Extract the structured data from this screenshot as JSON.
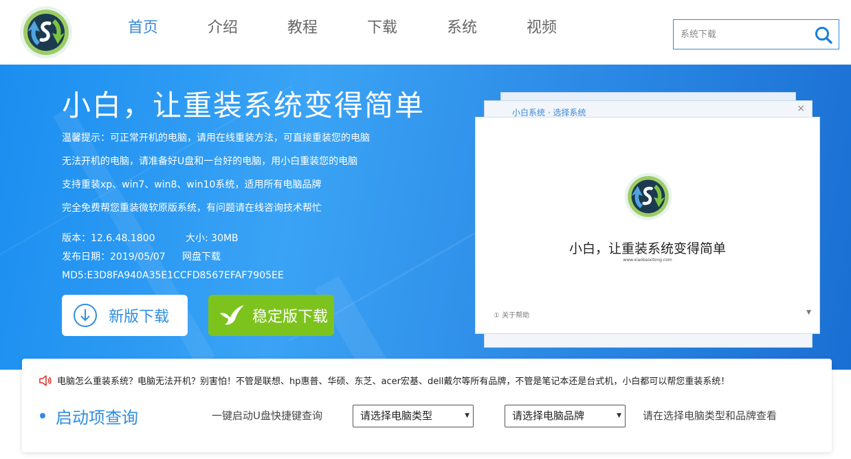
{
  "header": {
    "logo_icon": "xiaobai-logo",
    "nav": [
      {
        "label": "首页",
        "active": true
      },
      {
        "label": "介绍",
        "active": false
      },
      {
        "label": "教程",
        "active": false
      },
      {
        "label": "下载",
        "active": false
      },
      {
        "label": "系统",
        "active": false
      },
      {
        "label": "视频",
        "active": false
      }
    ],
    "search": {
      "placeholder": "系统下载",
      "icon": "search-icon"
    }
  },
  "banner": {
    "title": "小白，让重装系统变得简单",
    "tips": [
      "温馨提示：可正常开机的电脑，请用在线重装方法，可直接重装您的电脑",
      "无法开机的电脑，请准备好U盘和一台好的电脑，用小白重装您的电脑",
      "支持重装xp、win7、win8、win10系统，适用所有电脑品牌",
      "完全免费帮您重装微软原版系统，有问题请在线咨询技术帮忙"
    ],
    "version": "版本：12.6.48.1800",
    "size": "大小: 30MB",
    "release_date": "发布日期：2019/05/07",
    "netdisk_link": "网盘下载",
    "md5": "MD5:E3D8FA940A35E1CCFD8567EFAF7905EE",
    "new_download_label": "新版下载",
    "stable_download_label": "稳定版下载",
    "colors": {
      "stable_button": "#7dc31d",
      "accent": "#2f8de0"
    }
  },
  "mockup": {
    "back_window_title": "小白系统 · 选择系统",
    "close_glyph": "×",
    "app_name": "小白，让重装系统变得简单",
    "app_url": "www.xiaobaixitong.com",
    "footer_text": "① 关于帮助",
    "footer_arrow": "▼"
  },
  "info": {
    "notice": "电脑怎么重装系统？电脑无法开机？别害怕！不管是联想、hp惠普、华硕、东芝、acer宏基、dell戴尔等所有品牌，不管是笔记本还是台式机，小白都可以帮您重装系统！",
    "boot_title": "启动项查询",
    "hotkey_label": "一键启动U盘快捷键查询",
    "type_select": "请选择电脑类型",
    "brand_select": "请选择电脑品牌",
    "caret": "▼",
    "hint": "请在选择电脑类型和品牌查看"
  }
}
